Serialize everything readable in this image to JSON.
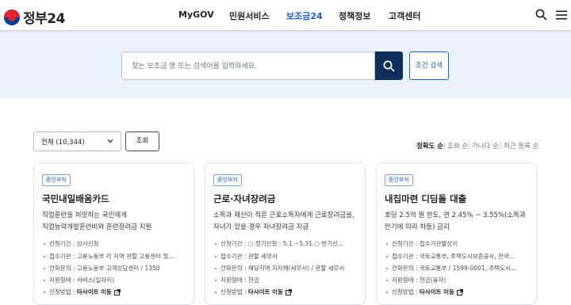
{
  "header": {
    "logo_text": "정부24",
    "nav": [
      "MyGOV",
      "민원서비스",
      "보조금24",
      "정책정보",
      "고객센터"
    ],
    "active_nav": "보조금24"
  },
  "search": {
    "placeholder": "찾는 보조금 명 또는 검색어를 입력하세요.",
    "advanced_label": "조건 검색"
  },
  "filter": {
    "selected": "전체 (10,344)",
    "query_label": "조회"
  },
  "sort": {
    "options": [
      "정확도 순",
      "조회 순",
      "가나다 순",
      "최근 등록 순"
    ],
    "active": "정확도 순"
  },
  "cards": [
    {
      "badge": "중앙부처",
      "title": "국민내일배움카드",
      "desc": [
        "직업훈련을 희망하는 국민에게",
        "직업능력개발훈련비와 훈련장려금 지원"
      ],
      "info": [
        {
          "label": "신청기간",
          "value": "상시신청"
        },
        {
          "label": "접수기관",
          "value": "고용노동부 각 지역 관할 고용센터 및..."
        },
        {
          "label": "전화문의",
          "value": "고용노동부 고객상담센터 / 1350"
        },
        {
          "label": "지원형태",
          "value": "서비스(일자리)"
        },
        {
          "label": "신청방법",
          "value": "타사이트 이동"
        }
      ]
    },
    {
      "badge": "중앙부처",
      "title": "근로·자녀장려금",
      "desc": [
        "소득과 재산이 적은 근로소득자에게 근로장려금을,",
        "자녀가 있을 경우 자녀장려금 지급"
      ],
      "info": [
        {
          "label": "신청기간",
          "value": "○ 정기신청 : 5.1.~5.31.○ 반기신..."
        },
        {
          "label": "접수기관",
          "value": "관할 세무서"
        },
        {
          "label": "전화문의",
          "value": "해당지역 지자체(세무서) / 관할 세무서"
        },
        {
          "label": "지원형태",
          "value": "현금"
        },
        {
          "label": "신청방법",
          "value": "타사이트 이동"
        }
      ]
    },
    {
      "badge": "중앙부처",
      "title": "내집마련 디딤돌 대출",
      "desc": [
        "호당 2.5억 원 한도, 연 2.45% ~ 3.55%(소득과",
        "만기에 따라 차등) 금리"
      ],
      "info": [
        {
          "label": "신청기간",
          "value": "접수기관별상이"
        },
        {
          "label": "접수기관",
          "value": "국토교통부, 주택도시보증공사, 한국..."
        },
        {
          "label": "전화문의",
          "value": "국토교통부 / 1599-0001, 주택도시..."
        },
        {
          "label": "지원형태",
          "value": "현금(융자)"
        },
        {
          "label": "신청방법",
          "value": "타사이트 이동"
        }
      ]
    }
  ],
  "colors": {
    "accent": "#1d5ec6",
    "search_button": "#0e2f5c",
    "hero_bg": "#e9f1fb"
  }
}
